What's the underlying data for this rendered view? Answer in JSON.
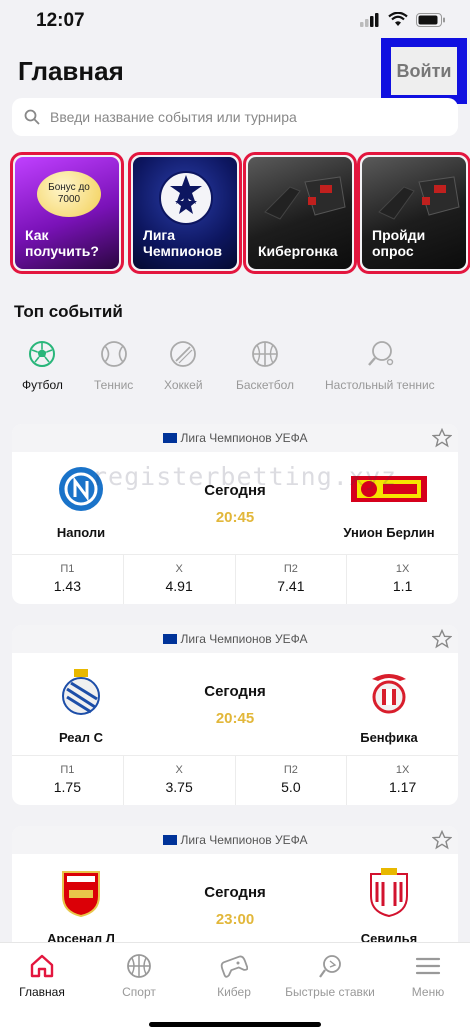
{
  "status": {
    "time": "12:07"
  },
  "header": {
    "title": "Главная",
    "login_label": "Войти"
  },
  "search": {
    "placeholder": "Введи название события или турнира"
  },
  "promos": [
    {
      "label": "Как получить?",
      "badge": "Бонус до 7000"
    },
    {
      "label": "Лига Чемпионов"
    },
    {
      "label": "Кибергонка"
    },
    {
      "label": "Пройди опрос"
    }
  ],
  "top_events": {
    "title": "Топ событий",
    "sports": [
      {
        "label": "Футбол",
        "icon": "football-icon",
        "active": true
      },
      {
        "label": "Теннис",
        "icon": "tennis-icon"
      },
      {
        "label": "Хоккей",
        "icon": "hockey-icon"
      },
      {
        "label": "Баскетбол",
        "icon": "basketball-icon"
      },
      {
        "label": "Настольный теннис",
        "icon": "table-tennis-icon"
      }
    ]
  },
  "watermark": "registerbetting.xyz",
  "matches": [
    {
      "league": "Лига Чемпионов УЕФА",
      "home": "Наполи",
      "away": "Унион Берлин",
      "day": "Сегодня",
      "time": "20:45",
      "odds": [
        {
          "label": "П1",
          "value": "1.43"
        },
        {
          "label": "X",
          "value": "4.91"
        },
        {
          "label": "П2",
          "value": "7.41"
        },
        {
          "label": "1X",
          "value": "1.1"
        }
      ]
    },
    {
      "league": "Лига Чемпионов УЕФА",
      "home": "Реал С",
      "away": "Бенфика",
      "day": "Сегодня",
      "time": "20:45",
      "odds": [
        {
          "label": "П1",
          "value": "1.75"
        },
        {
          "label": "X",
          "value": "3.75"
        },
        {
          "label": "П2",
          "value": "5.0"
        },
        {
          "label": "1X",
          "value": "1.17"
        }
      ]
    },
    {
      "league": "Лига Чемпионов УЕФА",
      "home": "Арсенал Л",
      "away": "Севилья",
      "day": "Сегодня",
      "time": "23:00"
    }
  ],
  "tabbar": [
    {
      "label": "Главная",
      "icon": "home-icon",
      "active": true
    },
    {
      "label": "Спорт",
      "icon": "basketball-icon"
    },
    {
      "label": "Кибер",
      "icon": "gamepad-icon"
    },
    {
      "label": "Быстрые ставки",
      "icon": "lightning-ball-icon"
    },
    {
      "label": "Меню",
      "icon": "menu-icon"
    }
  ],
  "colors": {
    "accent": "#e3163e",
    "time": "#e2b73a",
    "login_highlight": "#1010e0"
  }
}
